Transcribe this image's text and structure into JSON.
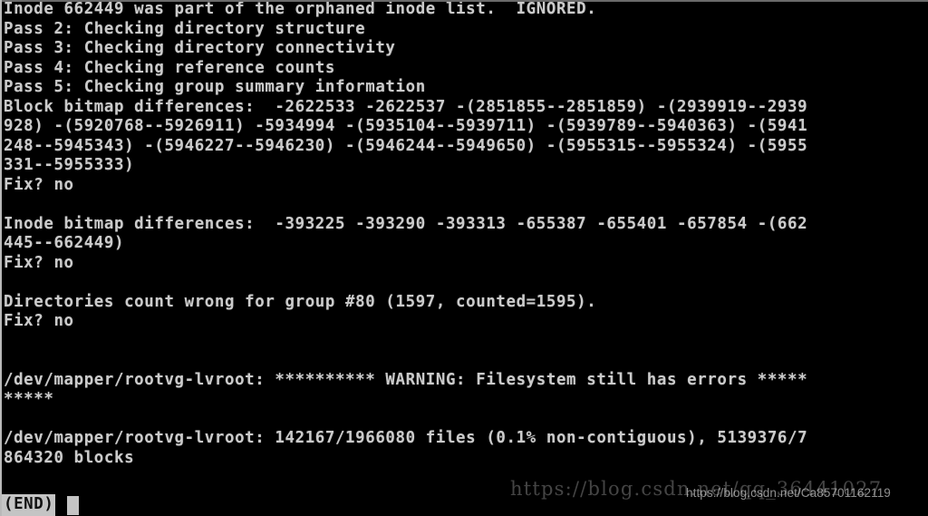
{
  "terminal": {
    "background_color": "#000000",
    "foreground_color": "#cbcbcb",
    "device": "/dev/mapper/rootvg-lvroot",
    "lines": [
      "Inode 662449 was part of the orphaned inode list.  IGNORED.",
      "Pass 2: Checking directory structure",
      "Pass 3: Checking directory connectivity",
      "Pass 4: Checking reference counts",
      "Pass 5: Checking group summary information",
      "Block bitmap differences:  -2622533 -2622537 -(2851855--2851859) -(2939919--2939",
      "928) -(5920768--5926911) -5934994 -(5935104--5939711) -(5939789--5940363) -(5941",
      "248--5945343) -(5946227--5946230) -(5946244--5949650) -(5955315--5955324) -(5955",
      "331--5955333)",
      "Fix? no",
      "",
      "Inode bitmap differences:  -393225 -393290 -393313 -655387 -655401 -657854 -(662",
      "445--662449)",
      "Fix? no",
      "",
      "Directories count wrong for group #80 (1597, counted=1595).",
      "Fix? no",
      "",
      "",
      "/dev/mapper/rootvg-lvroot: ********** WARNING: Filesystem still has errors *****",
      "*****",
      "",
      "/dev/mapper/rootvg-lvroot: 142167/1966080 files (0.1% non-contiguous), 5139376/7",
      "864320 blocks"
    ],
    "status": {
      "label": "(END)",
      "cursor_visible": true
    }
  },
  "fsck_summary": {
    "passes": [
      "Pass 2: Checking directory structure",
      "Pass 3: Checking directory connectivity",
      "Pass 4: Checking reference counts",
      "Pass 5: Checking group summary information"
    ],
    "orphaned_inode": "662449",
    "orphaned_inode_action": "IGNORED.",
    "block_bitmap_differences": [
      "-2622533",
      "-2622537",
      "-(2851855--2851859)",
      "-(2939919--2939928)",
      "-(5920768--5926911)",
      "-5934994",
      "-(5935104--5939711)",
      "-(5939789--5940363)",
      "-(5941248--5945343)",
      "-(5946227--5946230)",
      "-(5946244--5949650)",
      "-(5955315--5955324)",
      "-(5955331--5955333)"
    ],
    "inode_bitmap_differences": [
      "-393225",
      "-393290",
      "-393313",
      "-655387",
      "-655401",
      "-657854",
      "-(662445--662449)"
    ],
    "fix_prompts": [
      "Fix? no",
      "Fix? no",
      "Fix? no"
    ],
    "directories_count_group": "#80",
    "directories_count_expected": "1597",
    "directories_count_counted": "1595",
    "warning_text": "WARNING: Filesystem still has errors",
    "warning_stars": "**********",
    "files_used": "142167",
    "files_total": "1966080",
    "non_contiguous_percent": "0.1%",
    "blocks_used": "5139376",
    "blocks_total": "7864320"
  },
  "watermarks": {
    "large": "https://blog.csdn.net/qq_36441027",
    "small": "https://blog.csdn.net/Ca85701162119"
  }
}
